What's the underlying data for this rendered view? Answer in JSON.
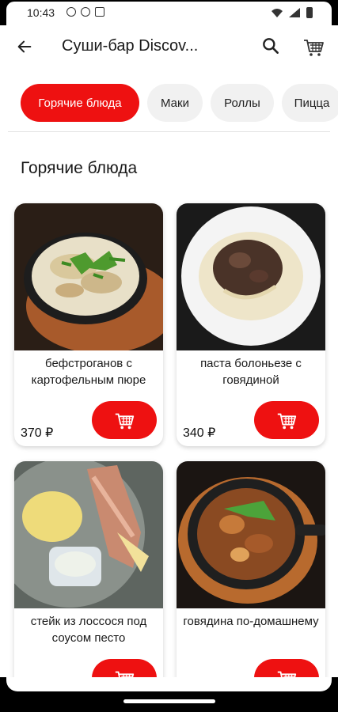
{
  "status_bar": {
    "time": "10:43"
  },
  "app_bar": {
    "title": "Суши-бар Discov..."
  },
  "categories": [
    {
      "label": "Горячие блюда",
      "active": true
    },
    {
      "label": "Маки",
      "active": false
    },
    {
      "label": "Роллы",
      "active": false
    },
    {
      "label": "Пицца",
      "active": false
    }
  ],
  "section": {
    "title": "Горячие блюда"
  },
  "products": [
    {
      "name": "бефстроганов с картофельным пюре",
      "price": "370 ₽"
    },
    {
      "name": "паста болоньезе с говядиной",
      "price": "340 ₽"
    },
    {
      "name": "стейк из лоссося под соусом песто",
      "price": ""
    },
    {
      "name": "говядина по-домашнему",
      "price": ""
    }
  ],
  "colors": {
    "accent": "#ee1111",
    "chip_bg": "#f1f1f1"
  },
  "icons": [
    "back-arrow-icon",
    "search-icon",
    "cart-icon",
    "add-to-cart-icon"
  ]
}
